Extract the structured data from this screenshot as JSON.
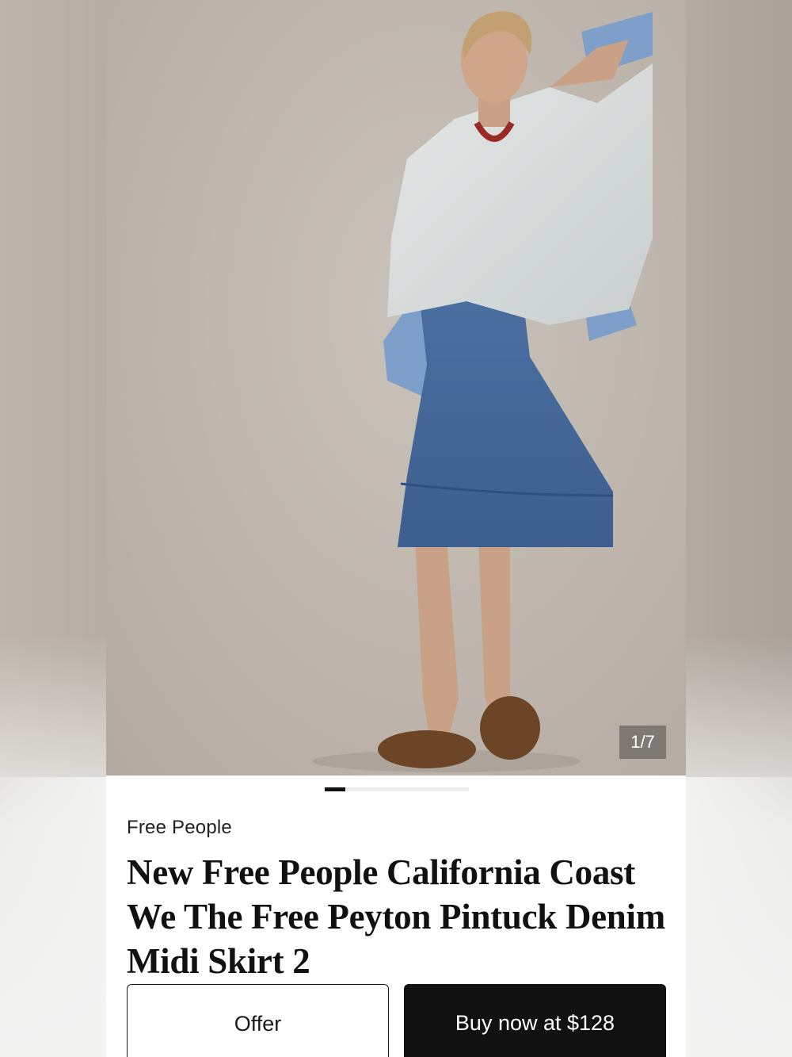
{
  "listing": {
    "image_counter": "1/7",
    "gallery": {
      "current_index": 1,
      "total_images": 7
    },
    "brand": "Free People",
    "title": "New Free People California Coast We The Free Peyton Pintuck Denim Midi Skirt 2"
  },
  "actions": {
    "offer_label": "Offer",
    "buy_label": "Buy now at $128"
  },
  "colors": {
    "primary_button": "#111111",
    "page_background": "#f2f2f1"
  }
}
